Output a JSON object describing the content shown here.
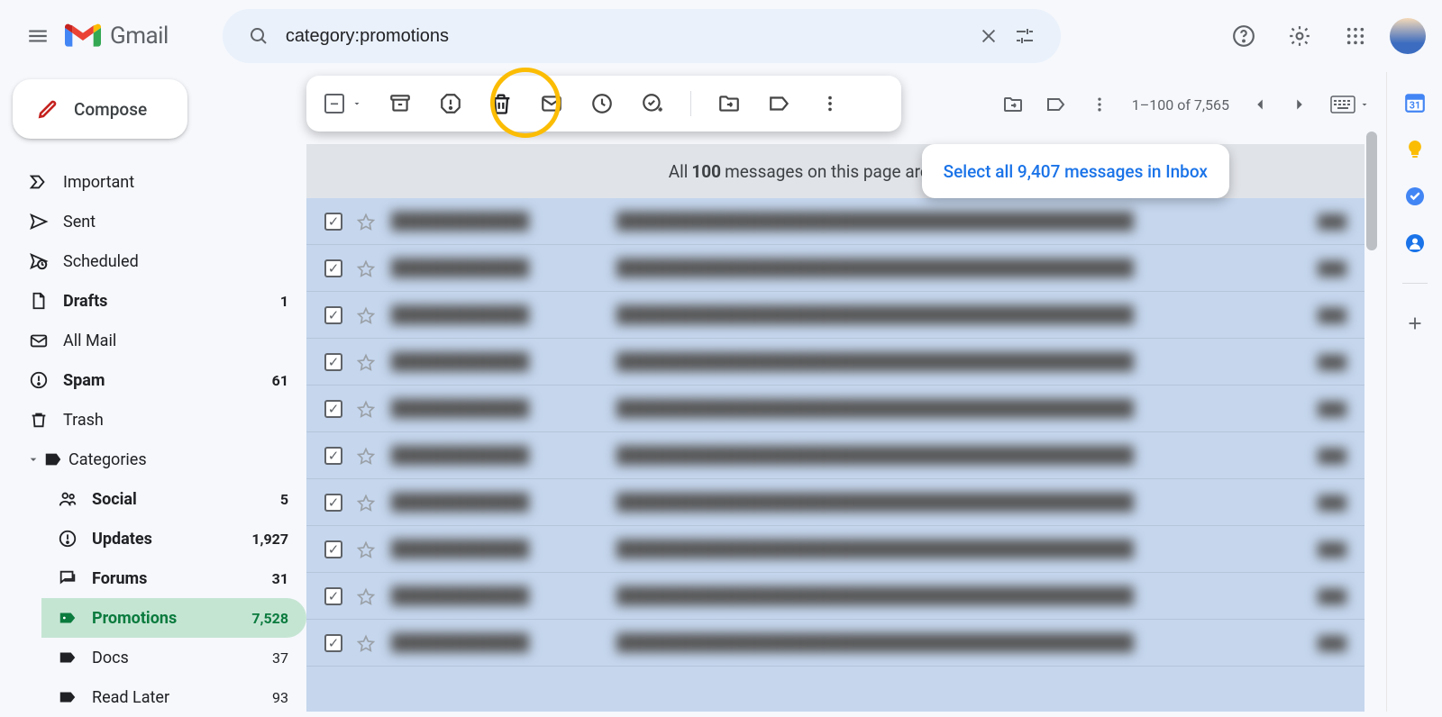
{
  "header": {
    "logo_text": "Gmail"
  },
  "search": {
    "value": "category:promotions"
  },
  "compose": {
    "label": "Compose"
  },
  "sidebar": {
    "items": [
      {
        "icon": "important",
        "label": "Important",
        "count": "",
        "bold": false
      },
      {
        "icon": "sent",
        "label": "Sent",
        "count": "",
        "bold": false
      },
      {
        "icon": "scheduled",
        "label": "Scheduled",
        "count": "",
        "bold": false
      },
      {
        "icon": "drafts",
        "label": "Drafts",
        "count": "1",
        "bold": true
      },
      {
        "icon": "allmail",
        "label": "All Mail",
        "count": "",
        "bold": false
      },
      {
        "icon": "spam",
        "label": "Spam",
        "count": "61",
        "bold": true
      },
      {
        "icon": "trash",
        "label": "Trash",
        "count": "",
        "bold": false
      }
    ],
    "categories_label": "Categories",
    "categories": [
      {
        "icon": "social",
        "label": "Social",
        "count": "5",
        "bold": true
      },
      {
        "icon": "updates",
        "label": "Updates",
        "count": "1,927",
        "bold": true
      },
      {
        "icon": "forums",
        "label": "Forums",
        "count": "31",
        "bold": true
      },
      {
        "icon": "promotions",
        "label": "Promotions",
        "count": "7,528",
        "bold": true,
        "active": true
      },
      {
        "icon": "label",
        "label": "Docs",
        "count": "37",
        "bold": false
      },
      {
        "icon": "label",
        "label": "Read Later",
        "count": "93",
        "bold": false
      }
    ]
  },
  "toolbar": {
    "message_count": "1–100 of 7,565"
  },
  "selection_banner": {
    "prefix": "All ",
    "count": "100",
    "suffix": " messages on this page are selected.",
    "link": "Select all 9,407 messages in Inbox"
  },
  "mail_rows": 10
}
